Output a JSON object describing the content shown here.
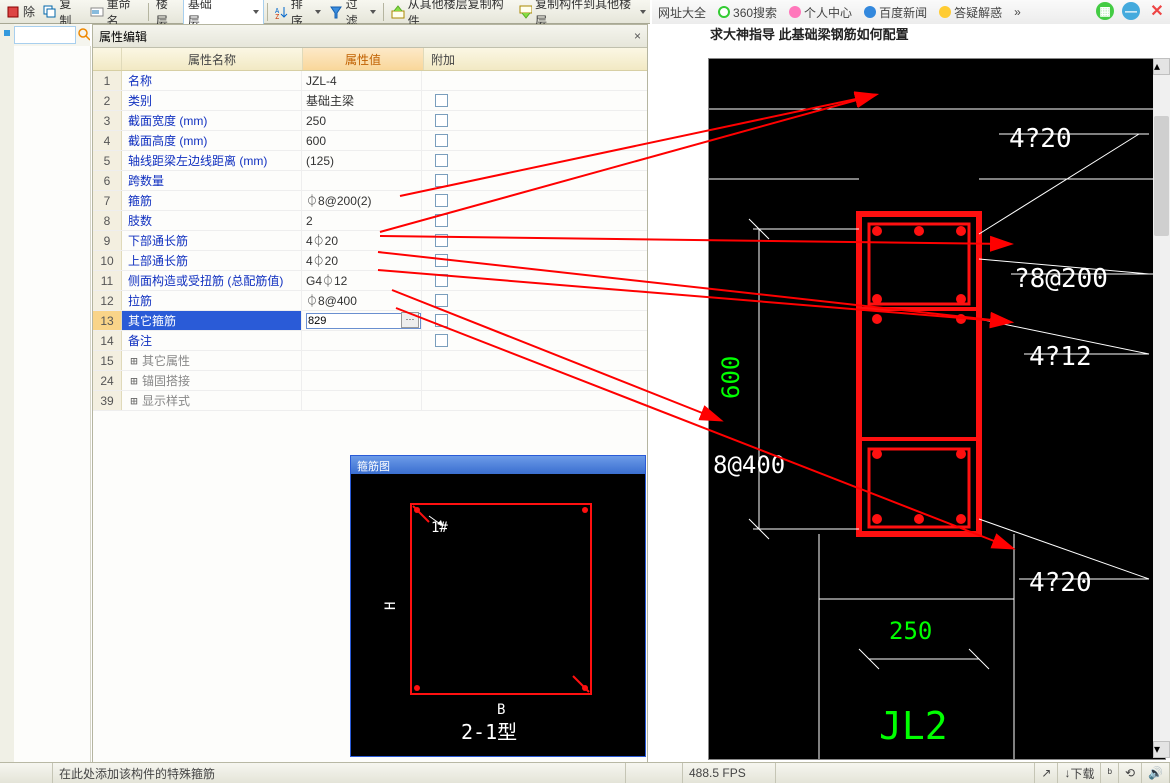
{
  "toolbar": {
    "items": [
      "除",
      "复制",
      "重命名",
      "楼层",
      "基础层",
      "排序",
      "过滤",
      "从其他楼层复制构件",
      "复制构件到其他楼层"
    ]
  },
  "browserBar": {
    "items": [
      "网址大全",
      "360搜索",
      "个人中心",
      "百度新闻",
      "答疑解惑"
    ],
    "more": "»"
  },
  "panel": {
    "title": "属性编辑",
    "headers": {
      "name": "属性名称",
      "value": "属性值",
      "add": "附加"
    }
  },
  "rows": [
    {
      "n": "1",
      "name": "名称",
      "val": "JZL-4",
      "link": true,
      "cb": false
    },
    {
      "n": "2",
      "name": "类别",
      "val": "基础主梁",
      "link": true,
      "cb": true
    },
    {
      "n": "3",
      "name": "截面宽度 (mm)",
      "val": "250",
      "link": true,
      "cb": true
    },
    {
      "n": "4",
      "name": "截面高度 (mm)",
      "val": "600",
      "link": true,
      "cb": true
    },
    {
      "n": "5",
      "name": "轴线距梁左边线距离 (mm)",
      "val": "(125)",
      "link": true,
      "cb": true
    },
    {
      "n": "6",
      "name": "跨数量",
      "val": "",
      "link": true,
      "cb": true
    },
    {
      "n": "7",
      "name": "箍筋",
      "val": "⏀8@200(2)",
      "link": true,
      "cb": true
    },
    {
      "n": "8",
      "name": "肢数",
      "val": "2",
      "link": true,
      "cb": true
    },
    {
      "n": "9",
      "name": "下部通长筋",
      "val": "4⏀20",
      "link": true,
      "cb": true
    },
    {
      "n": "10",
      "name": "上部通长筋",
      "val": "4⏀20",
      "link": true,
      "cb": true
    },
    {
      "n": "11",
      "name": "侧面构造或受扭筋 (总配筋值)",
      "val": "G4⏀12",
      "link": true,
      "cb": true
    },
    {
      "n": "12",
      "name": "拉筋",
      "val": "⏀8@400",
      "link": true,
      "cb": true
    },
    {
      "n": "13",
      "name": "其它箍筋",
      "val": "829",
      "link": true,
      "cb": true,
      "sel": true,
      "edit": true
    },
    {
      "n": "14",
      "name": "备注",
      "val": "",
      "link": true,
      "cb": true
    },
    {
      "n": "15",
      "name": "其它属性",
      "val": "",
      "gray": true,
      "exp": "+"
    },
    {
      "n": "24",
      "name": "锚固搭接",
      "val": "",
      "gray": true,
      "exp": "+"
    },
    {
      "n": "39",
      "name": "显示样式",
      "val": "",
      "gray": true,
      "exp": "+"
    }
  ],
  "stirrup": {
    "title": "箍筋图",
    "label1": "1#",
    "labelB": "B",
    "labelH": "H",
    "type": "2-1型"
  },
  "rightPane": {
    "title": "求大神指导 此基础梁钢筋如何配置"
  },
  "cad": {
    "t1": "4?20",
    "t2": "?8@200",
    "t3": "4?12",
    "t4": "4?20",
    "d600": "600",
    "d250": "250",
    "d8400": "8@400",
    "jl": "JL2"
  },
  "status": {
    "hint": "在此处添加该构件的特殊箍筋",
    "fps": "488.5 FPS",
    "dl": "下载"
  },
  "arrows": [
    [
      400,
      196,
      875,
      95
    ],
    [
      380,
      232,
      875,
      95
    ],
    [
      380,
      236,
      1010,
      244
    ],
    [
      378,
      252,
      1010,
      322
    ],
    [
      378,
      270,
      1010,
      322
    ],
    [
      392,
      290,
      720,
      420
    ],
    [
      396,
      308,
      1012,
      548
    ]
  ]
}
